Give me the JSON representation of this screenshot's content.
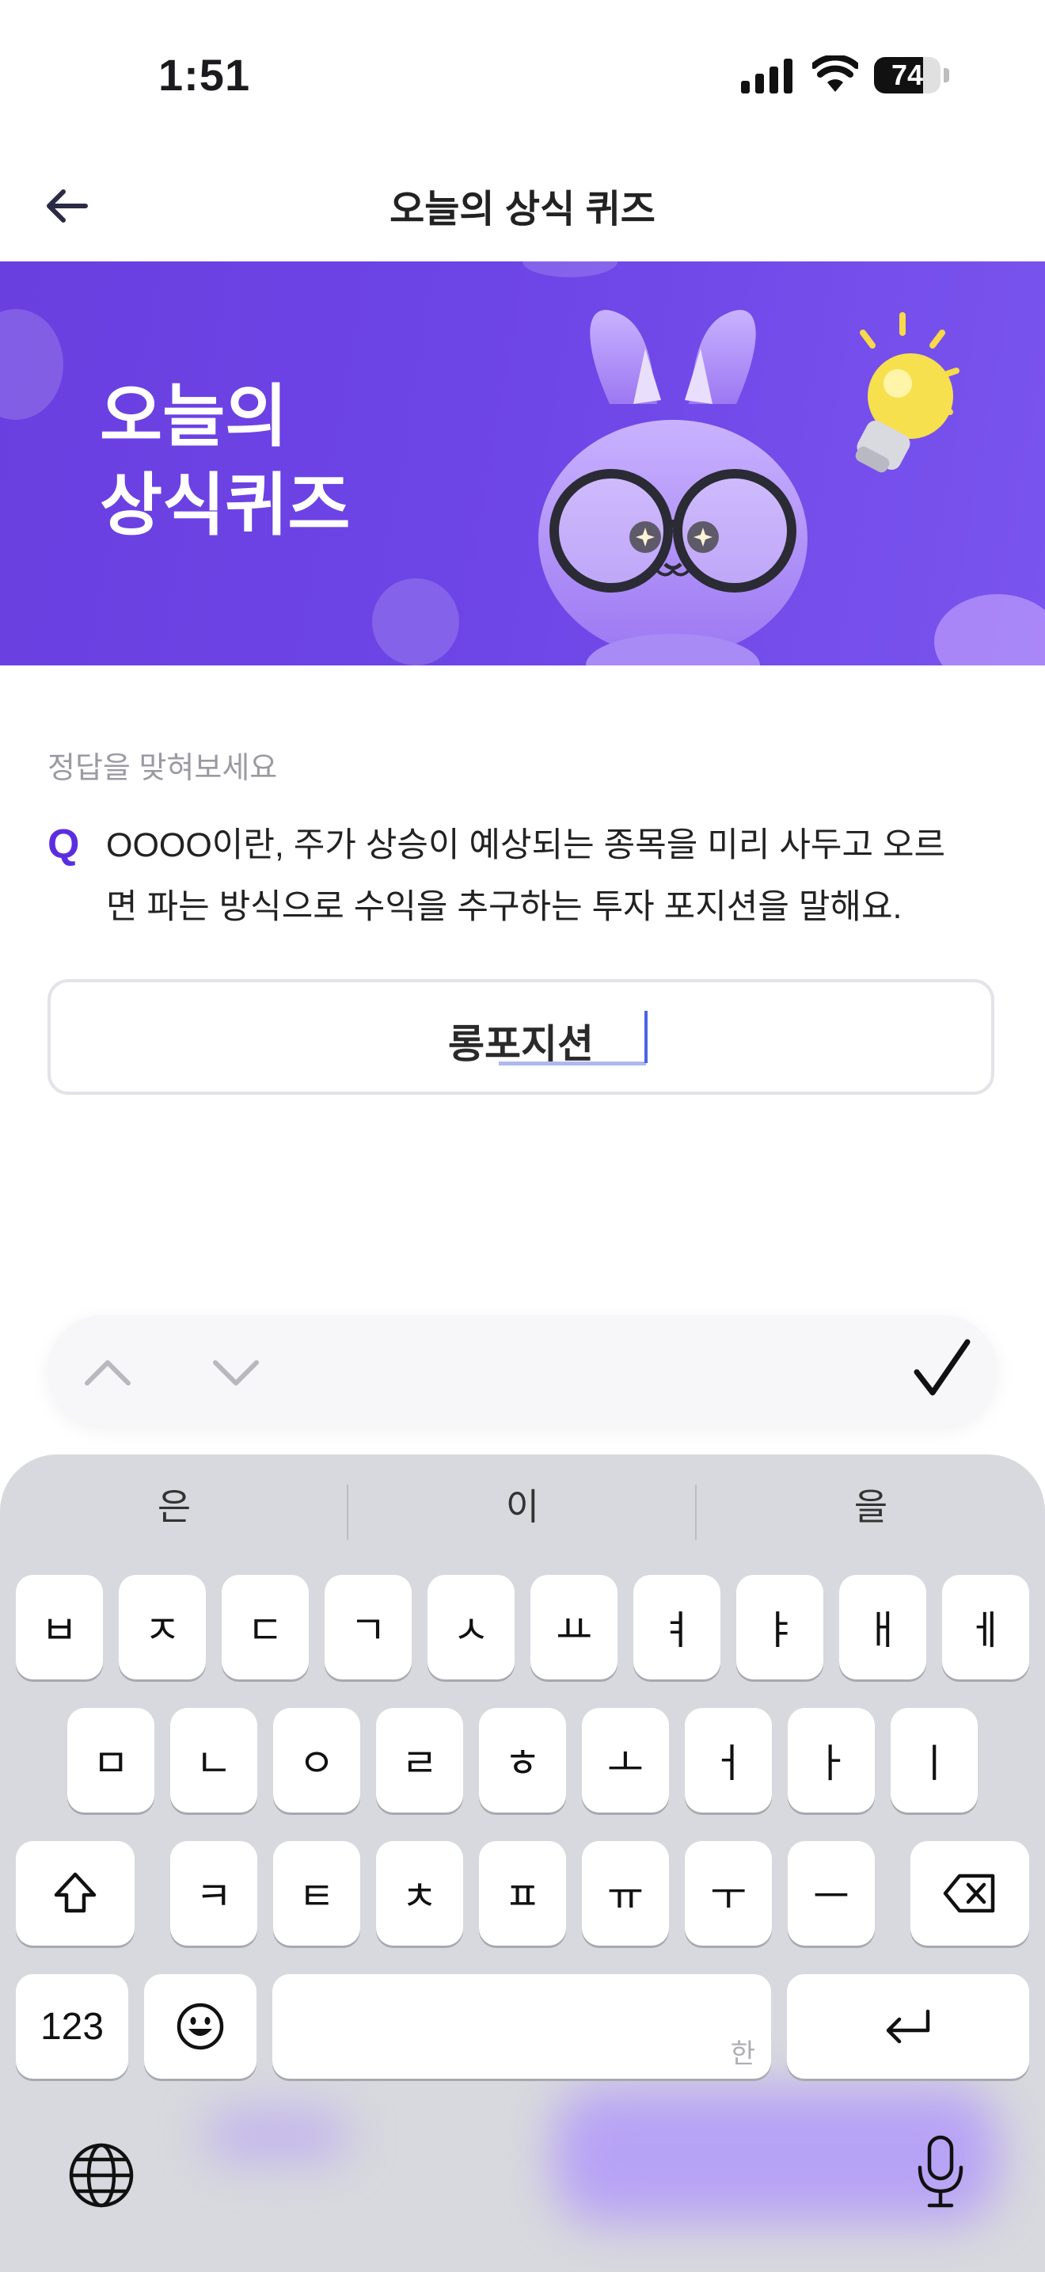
{
  "status_bar": {
    "time": "1:51",
    "battery": "74",
    "battery_level_fraction": 0.74
  },
  "header": {
    "title": "오늘의 상식 퀴즈"
  },
  "banner": {
    "title_line1": "오늘의",
    "title_line2": "상식퀴즈"
  },
  "quiz": {
    "prompt_label": "정답을 맞혀보세요",
    "q_mark": "Q",
    "question_line1": "OOOO이란, 주가 상승이 예상되는 종목을 미리 사두고 오르",
    "question_line2": "면 파는 방식으로 수익을 추구하는 투자 포지션을 말해요.",
    "answer_value": "롱포지션"
  },
  "keyboard": {
    "suggestions": [
      "은",
      "이",
      "을"
    ],
    "row1": [
      "ㅂ",
      "ㅈ",
      "ㄷ",
      "ㄱ",
      "ㅅ",
      "ㅛ",
      "ㅕ",
      "ㅑ",
      "ㅐ",
      "ㅔ"
    ],
    "row2": [
      "ㅁ",
      "ㄴ",
      "ㅇ",
      "ㄹ",
      "ㅎ",
      "ㅗ",
      "ㅓ",
      "ㅏ",
      "ㅣ"
    ],
    "row3": [
      "ㅋ",
      "ㅌ",
      "ㅊ",
      "ㅍ",
      "ㅠ",
      "ㅜ",
      "ㅡ"
    ],
    "numbers_key": "123",
    "space_hint": "한"
  },
  "colors": {
    "accent": "#5a2ee0",
    "banner": "#6b41e4"
  }
}
